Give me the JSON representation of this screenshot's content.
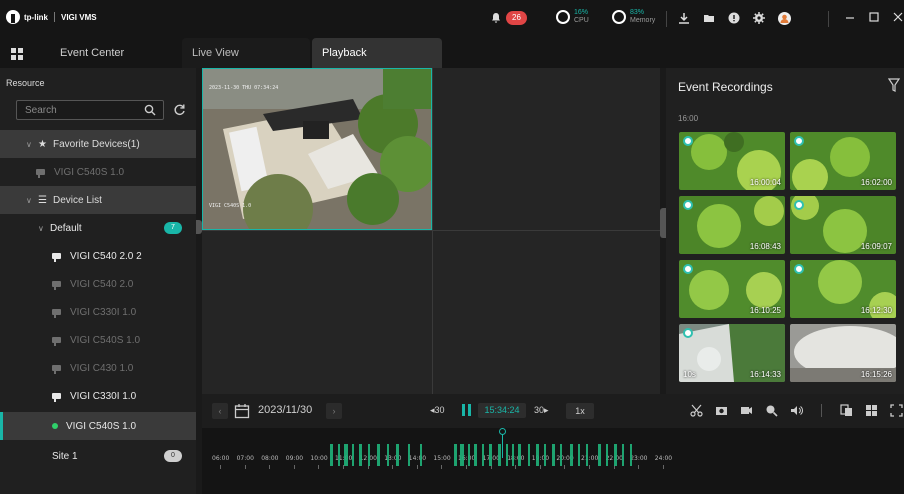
{
  "brand": {
    "tplink": "tp-link",
    "app": "VIGI VMS"
  },
  "topbar": {
    "notification_count": "26",
    "cpu": {
      "percent": "16%",
      "label": "CPU"
    },
    "memory": {
      "percent": "83%",
      "label": "Memory"
    }
  },
  "tabs": [
    {
      "label": "Event Center"
    },
    {
      "label": "Live View"
    },
    {
      "label": "Playback"
    }
  ],
  "left": {
    "title": "Resource",
    "search_placeholder": "Search",
    "favorites_label": "Favorite Devices(1)",
    "favorite_item": "VIGI C540S 1.0",
    "device_list_label": "Device List",
    "group_label": "Default",
    "group_badge": "7",
    "devices": [
      "VIGI C540 2.0 2",
      "VIGI C540 2.0",
      "VIGI C330I 1.0",
      "VIGI C540S 1.0",
      "VIGI C430 1.0",
      "VIGI C330I 1.0",
      "VIGI C540S 1.0"
    ],
    "site_label": "Site 1",
    "site_badge": "0"
  },
  "video": {
    "timestamp": "2023-11-30 THU 07:34:24",
    "camera_name": "VIGI C540S 1.0"
  },
  "events": {
    "title": "Event Recordings",
    "section_time": "16:00",
    "thumbs": [
      {
        "time": "16:00:04",
        "scene": "green"
      },
      {
        "time": "16:02:00",
        "scene": "green"
      },
      {
        "time": "16:08:43",
        "scene": "green"
      },
      {
        "time": "16:09:07",
        "scene": "green"
      },
      {
        "time": "16:10:25",
        "scene": "green"
      },
      {
        "time": "16:12:30",
        "scene": "green"
      },
      {
        "time": "16:14:33",
        "scene": "indoor",
        "duration": "10s"
      },
      {
        "time": "16:15:26",
        "scene": "white"
      }
    ]
  },
  "control": {
    "date": "2023/11/30",
    "back": "◂30",
    "forward": "30▸",
    "play_time": "15:34:24",
    "speed": "1x"
  },
  "timeline": {
    "ticks": [
      "06:00",
      "07:00",
      "08:00",
      "09:00",
      "10:00",
      "11:00",
      "12:00",
      "13:00",
      "14:00",
      "15:00",
      "16:00",
      "17:00",
      "18:00",
      "19:00",
      "20:00",
      "21:00",
      "22:00",
      "23:00",
      "24:00"
    ],
    "playhead_time": "15:34:24"
  },
  "colors": {
    "accent": "#19b6a8",
    "record": "#1fb27a",
    "alert": "#e04545"
  }
}
